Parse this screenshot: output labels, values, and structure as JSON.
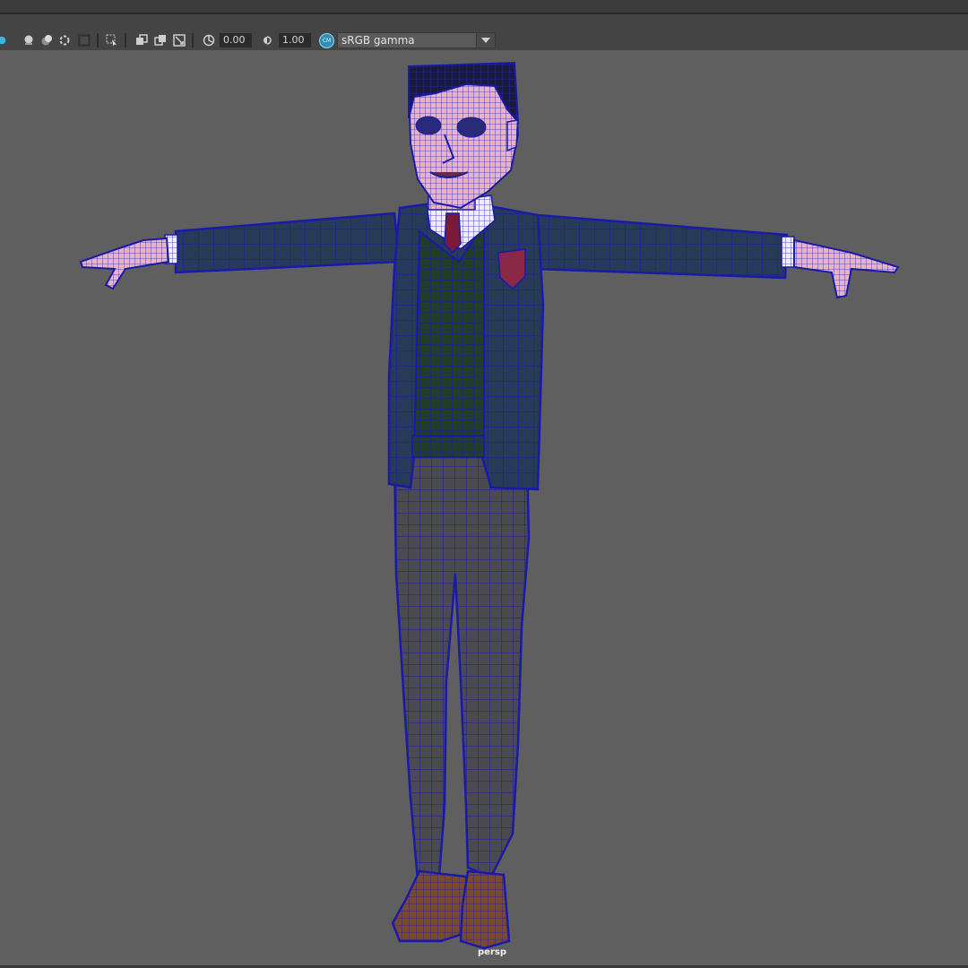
{
  "toolbar": {
    "exposure_value": "0.00",
    "gamma_value": "1.00",
    "color_management_badge": "CM",
    "view_transform": "sRGB gamma",
    "icons": [
      "light-icon",
      "xray-icon",
      "ambient-occlusion-icon",
      "motion-blur-icon",
      "antialias-icon",
      "isolate-select-icon",
      "shadows-icon",
      "two-sided-lighting-icon",
      "resolution-gate-icon",
      "exposure-icon",
      "gamma-icon"
    ]
  },
  "viewport": {
    "camera_label": "persp",
    "model": "character-wireframe-on-shaded",
    "colors": {
      "background": "#5f5f5f",
      "wireframe": "#1a1aa8",
      "jacket": "#273a58",
      "vest": "#1f3d28",
      "trousers": "#4a4a50",
      "skin": "#e7b6bd",
      "shoes": "#7a4a2a",
      "hair": "#1a1a3a",
      "tie": "#7a1a3a"
    }
  }
}
